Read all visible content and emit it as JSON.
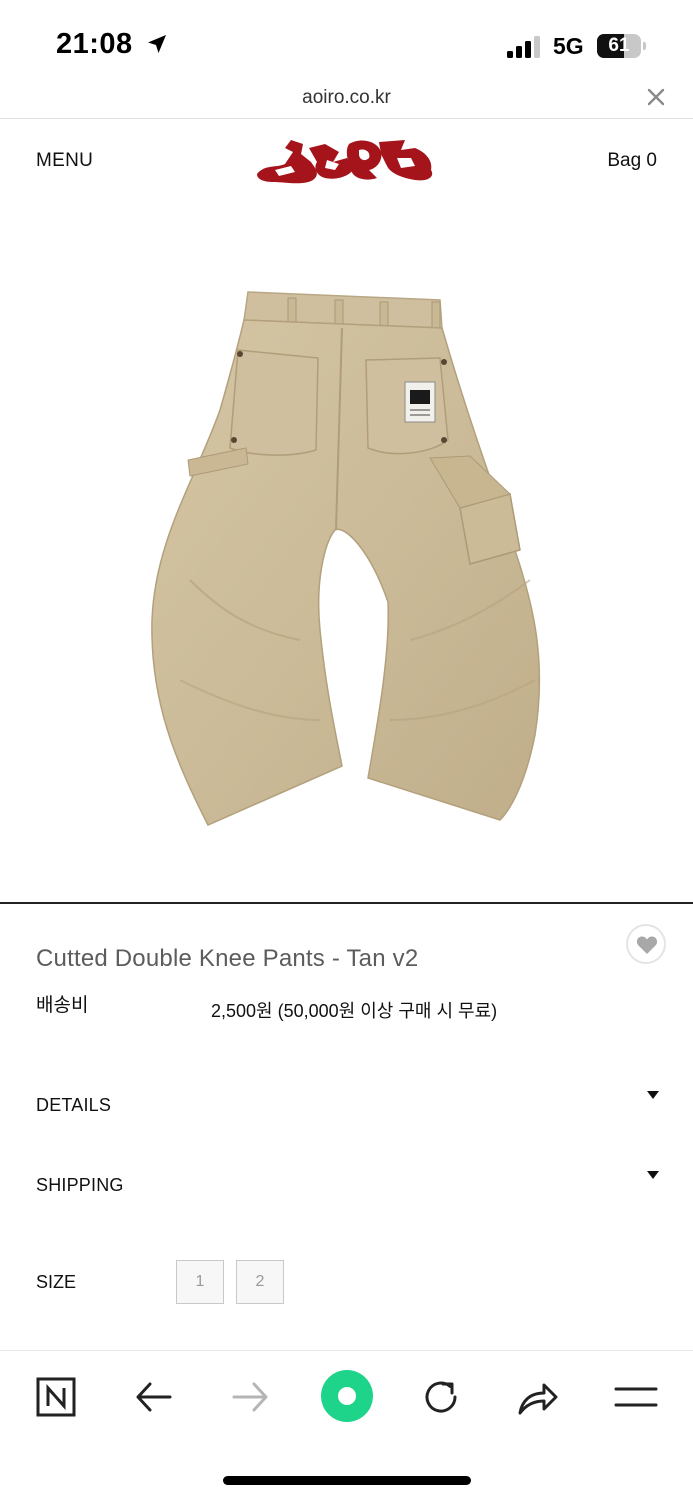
{
  "status_bar": {
    "time": "21:08",
    "network": "5G",
    "battery": "61",
    "battery_level": 0.61
  },
  "browser": {
    "url": "aoiro.co.kr",
    "close_icon": "close-icon"
  },
  "header": {
    "menu_label": "MENU",
    "logo_color": "#a5141b",
    "bag_label": "Bag 0"
  },
  "product": {
    "image_icon": "pants-photo",
    "title": "Cutted Double Knee Pants - Tan v2",
    "shipping_label": "배송비",
    "shipping_value": "2,500원 (50,000원 이상 구매 시 무료)",
    "wish_icon": "heart-icon"
  },
  "accordions": [
    {
      "label": "DETAILS",
      "icon": "caret-down-icon"
    },
    {
      "label": "SHIPPING",
      "icon": "caret-down-icon"
    }
  ],
  "size": {
    "label": "SIZE",
    "options": [
      "1",
      "2"
    ]
  },
  "toolbar": {
    "items": [
      "naver-home-icon",
      "back-arrow-icon",
      "forward-arrow-icon",
      "green-dot-icon",
      "reload-icon",
      "share-icon",
      "menu-icon"
    ],
    "accent_color": "#1ed38a"
  }
}
